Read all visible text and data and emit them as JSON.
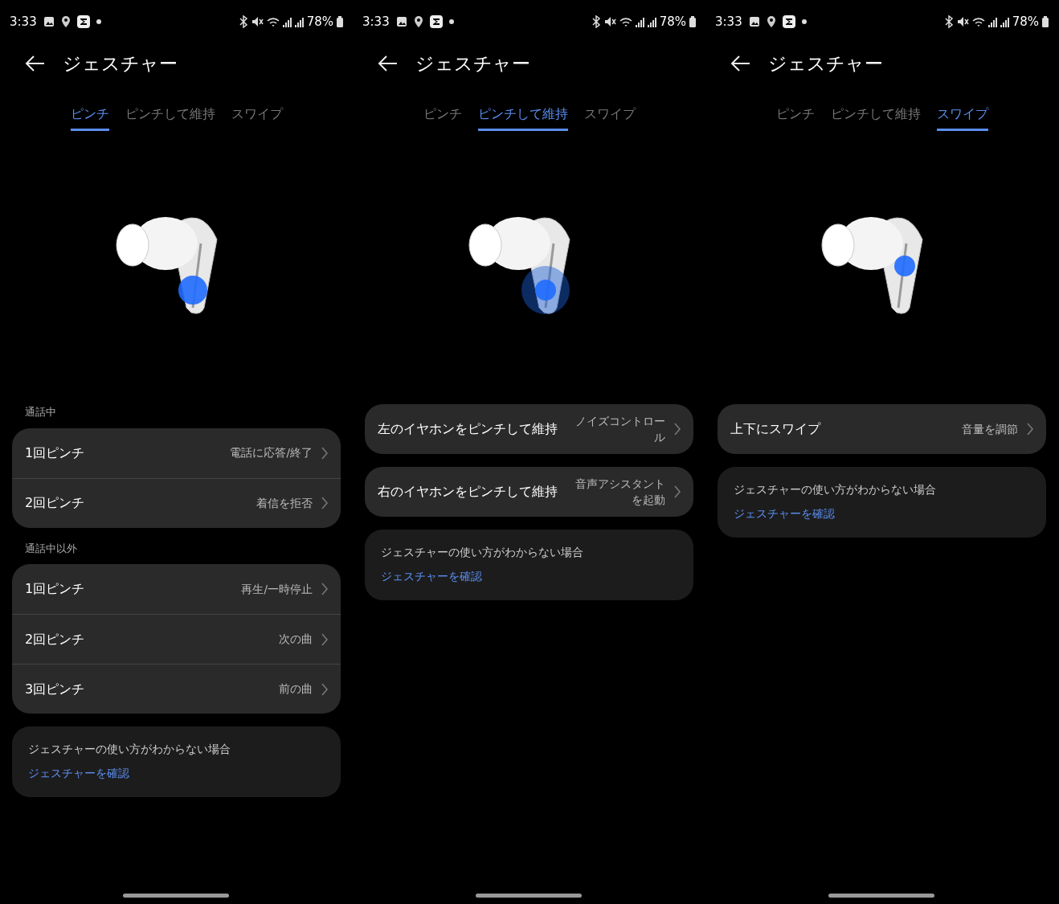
{
  "screens": [
    {
      "status_bar": {
        "time": "3:33",
        "battery": "78%"
      },
      "title": "ジェスチャー",
      "tabs": [
        {
          "label": "ピンチ",
          "selected": true
        },
        {
          "label": "ピンチして維持",
          "selected": false
        },
        {
          "label": "スワイプ",
          "selected": false
        }
      ],
      "groups": [
        {
          "header": "通話中",
          "rows": [
            {
              "label": "1回ピンチ",
              "value": "電話に応答/終了"
            },
            {
              "label": "2回ピンチ",
              "value": "着信を拒否"
            }
          ]
        },
        {
          "header": "通話中以外",
          "rows": [
            {
              "label": "1回ピンチ",
              "value": "再生/一時停止"
            },
            {
              "label": "2回ピンチ",
              "value": "次の曲"
            },
            {
              "label": "3回ピンチ",
              "value": "前の曲"
            }
          ]
        }
      ],
      "help": {
        "text": "ジェスチャーの使い方がわからない場合",
        "link": "ジェスチャーを確認"
      }
    },
    {
      "status_bar": {
        "time": "3:33",
        "battery": "78%"
      },
      "title": "ジェスチャー",
      "tabs": [
        {
          "label": "ピンチ",
          "selected": false
        },
        {
          "label": "ピンチして維持",
          "selected": true
        },
        {
          "label": "スワイプ",
          "selected": false
        }
      ],
      "groups": [
        {
          "rows": [
            {
              "label": "左のイヤホンをピンチして維持",
              "value": "ノイズコントロール"
            }
          ]
        },
        {
          "rows": [
            {
              "label": "右のイヤホンをピンチして維持",
              "value": "音声アシスタントを起動"
            }
          ]
        }
      ],
      "help": {
        "text": "ジェスチャーの使い方がわからない場合",
        "link": "ジェスチャーを確認"
      }
    },
    {
      "status_bar": {
        "time": "3:33",
        "battery": "78%"
      },
      "title": "ジェスチャー",
      "tabs": [
        {
          "label": "ピンチ",
          "selected": false
        },
        {
          "label": "ピンチして維持",
          "selected": false
        },
        {
          "label": "スワイプ",
          "selected": true
        }
      ],
      "groups": [
        {
          "rows": [
            {
              "label": "上下にスワイプ",
              "value": "音量を調節"
            }
          ]
        }
      ],
      "help": {
        "text": "ジェスチャーの使い方がわからない場合",
        "link": "ジェスチャーを確認"
      }
    }
  ]
}
